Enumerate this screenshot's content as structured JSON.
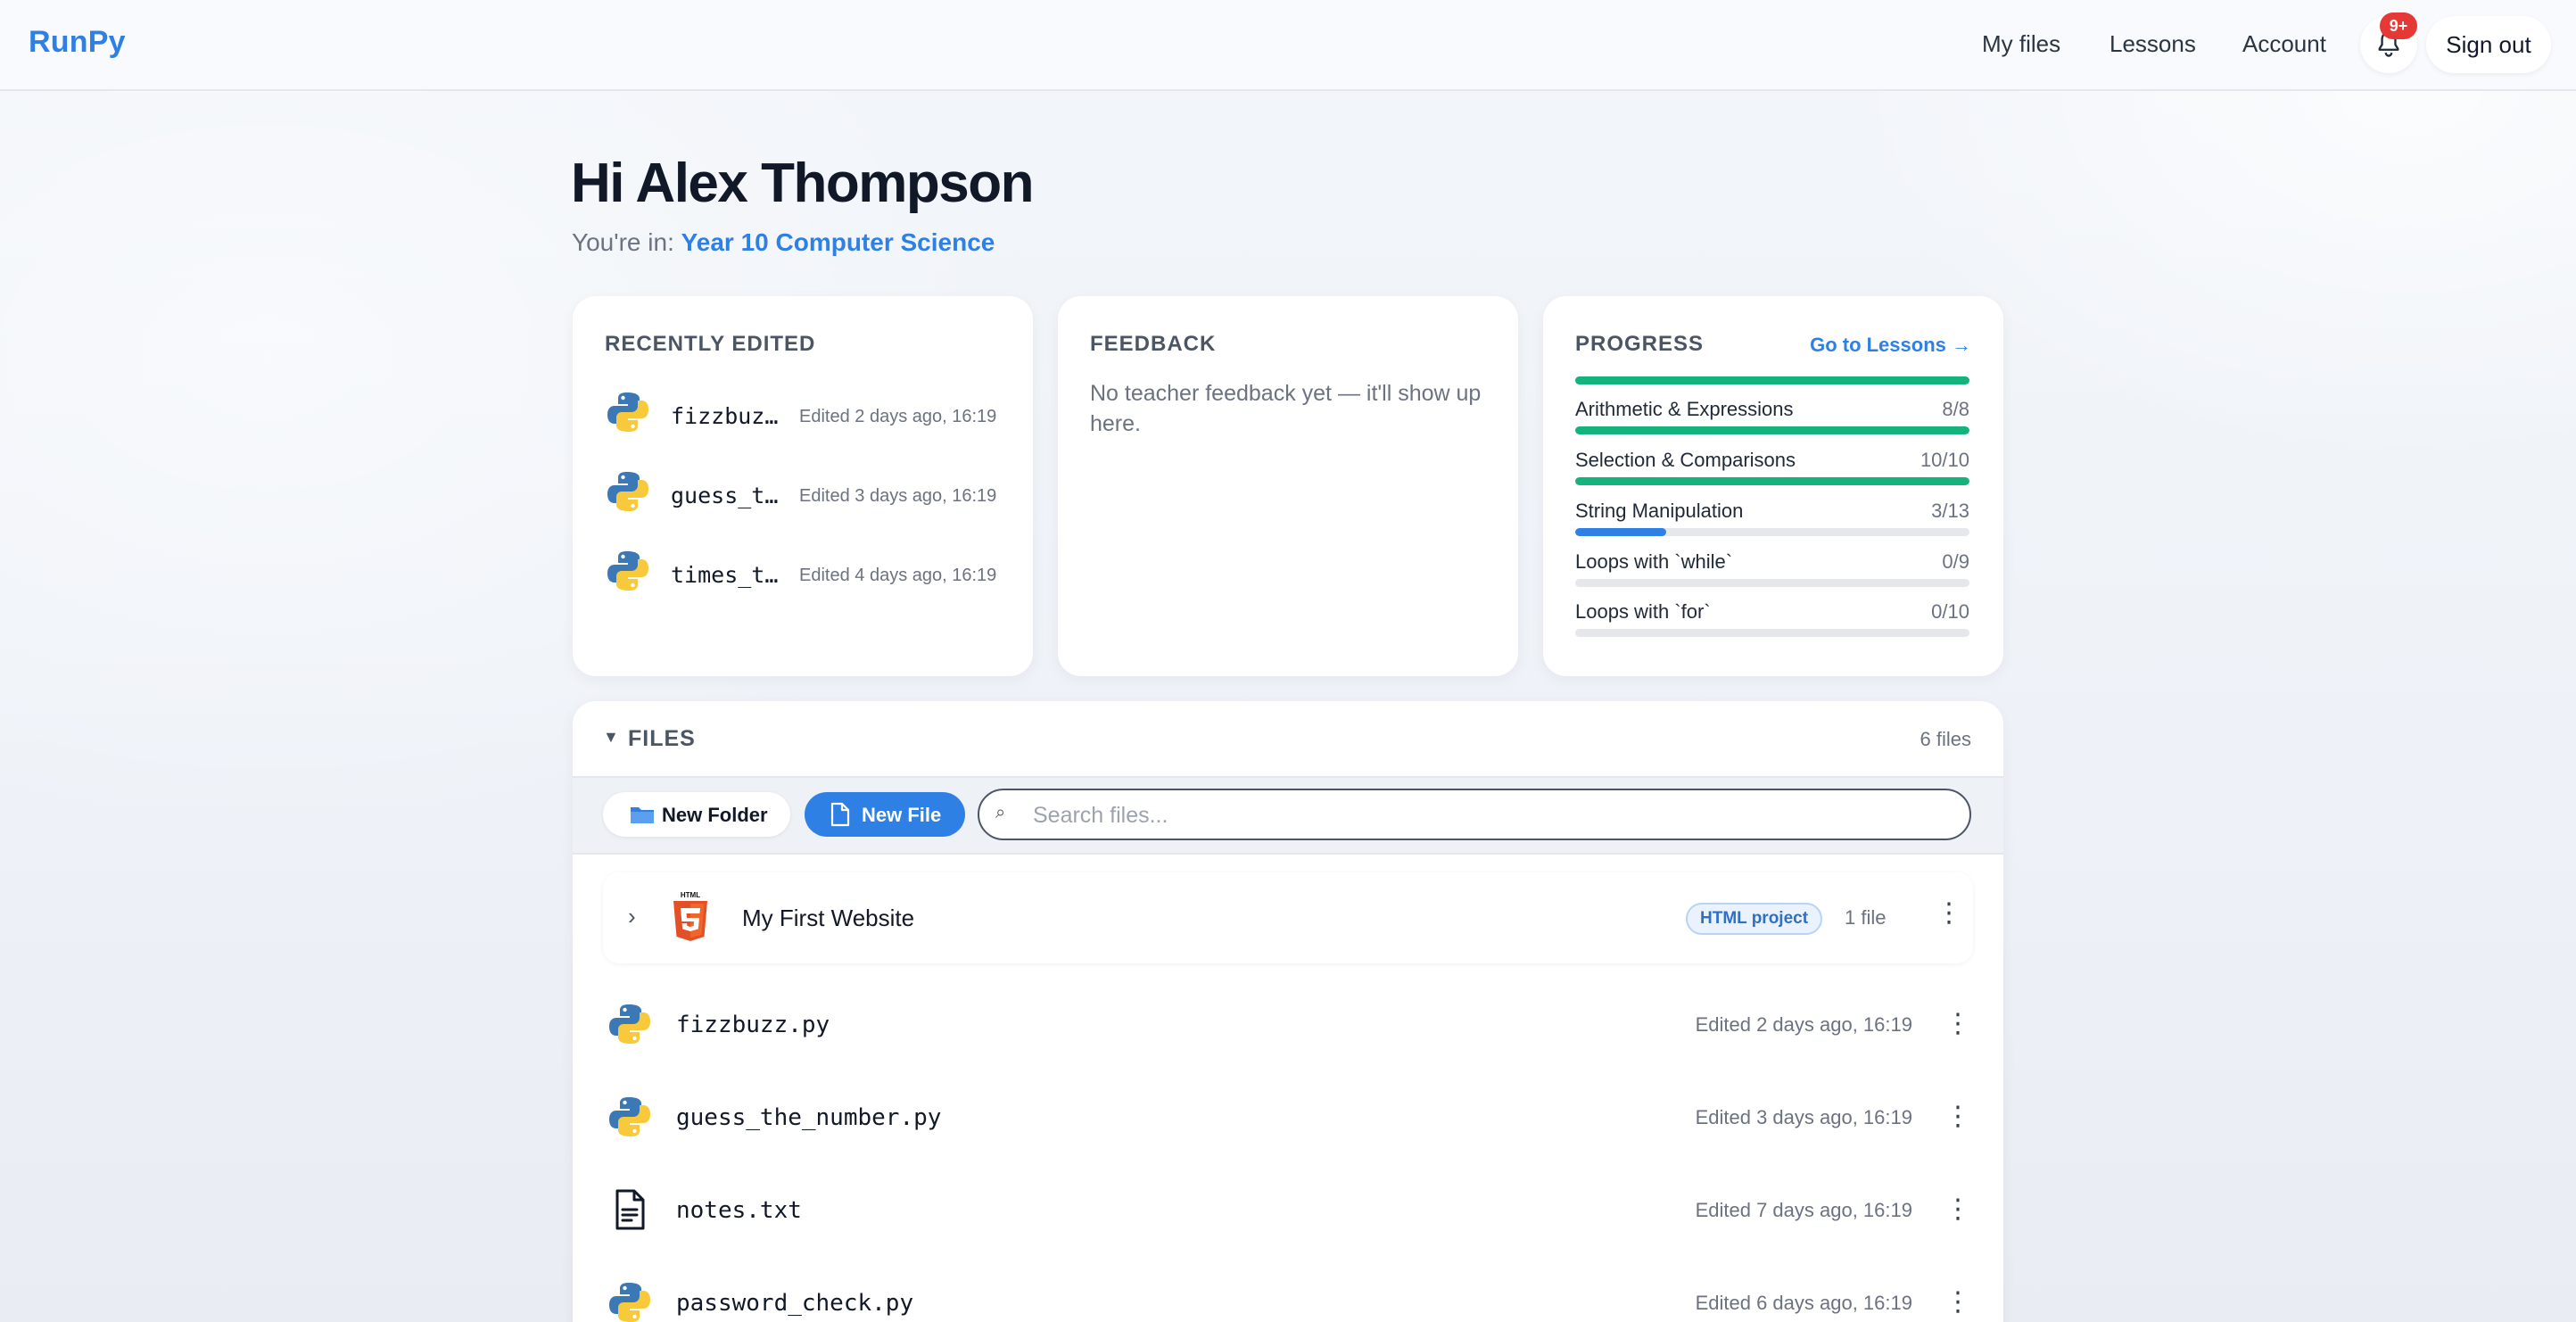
{
  "nav": {
    "brand": "RunPy",
    "links": [
      "My files",
      "Lessons",
      "Account"
    ],
    "notification_badge": "9+",
    "sign_out": "Sign out"
  },
  "greeting": {
    "title": "Hi Alex Thompson",
    "prefix": "You're in: ",
    "course": "Year 10 Computer Science"
  },
  "recent": {
    "title": "RECENTLY EDITED",
    "items": [
      {
        "name": "fizzbuzz.py",
        "edited": "Edited 2 days ago, 16:19"
      },
      {
        "name": "guess_the_number.py",
        "edited": "Edited 3 days ago, 16:19"
      },
      {
        "name": "times_tables.py",
        "edited": "Edited 4 days ago, 16:19"
      }
    ]
  },
  "feedback": {
    "title": "FEEDBACK",
    "text": "No teacher feedback yet — it'll show up here."
  },
  "progress": {
    "title": "PROGRESS",
    "link": "Go to Lessons →",
    "items": [
      {
        "name": "Arithmetic & Expressions",
        "count": "8/8",
        "fraction": 1.0,
        "color": "#14b37d"
      },
      {
        "name": "Selection & Comparisons",
        "count": "10/10",
        "fraction": 1.0,
        "color": "#14b37d"
      },
      {
        "name": "String Manipulation",
        "count": "3/13",
        "fraction": 0.2308,
        "color": "#2f80e4"
      },
      {
        "name": "Loops with `while`",
        "count": "0/9",
        "fraction": 0,
        "color": "#2f80e4"
      },
      {
        "name": "Loops with `for`",
        "count": "0/10",
        "fraction": 0,
        "color": "#2f80e4"
      }
    ]
  },
  "files": {
    "title": "FILES",
    "count": "6 files",
    "new_folder": "New Folder",
    "new_file": "New File",
    "search_placeholder": "Search files...",
    "folder": {
      "name": "My First Website",
      "badge": "HTML project",
      "count": "1 file"
    },
    "rows": [
      {
        "name": "fizzbuzz.py",
        "icon": "python-icon",
        "edited": "Edited 2 days ago, 16:19"
      },
      {
        "name": "guess_the_number.py",
        "icon": "python-icon",
        "edited": "Edited 3 days ago, 16:19"
      },
      {
        "name": "notes.txt",
        "icon": "text-file-icon",
        "edited": "Edited 7 days ago, 16:19"
      },
      {
        "name": "password_check.py",
        "icon": "python-icon",
        "edited": "Edited 6 days ago, 16:19"
      }
    ]
  },
  "colors": {
    "accent": "#2f80e4",
    "complete": "#14b37d",
    "badge_red": "#e53935"
  }
}
